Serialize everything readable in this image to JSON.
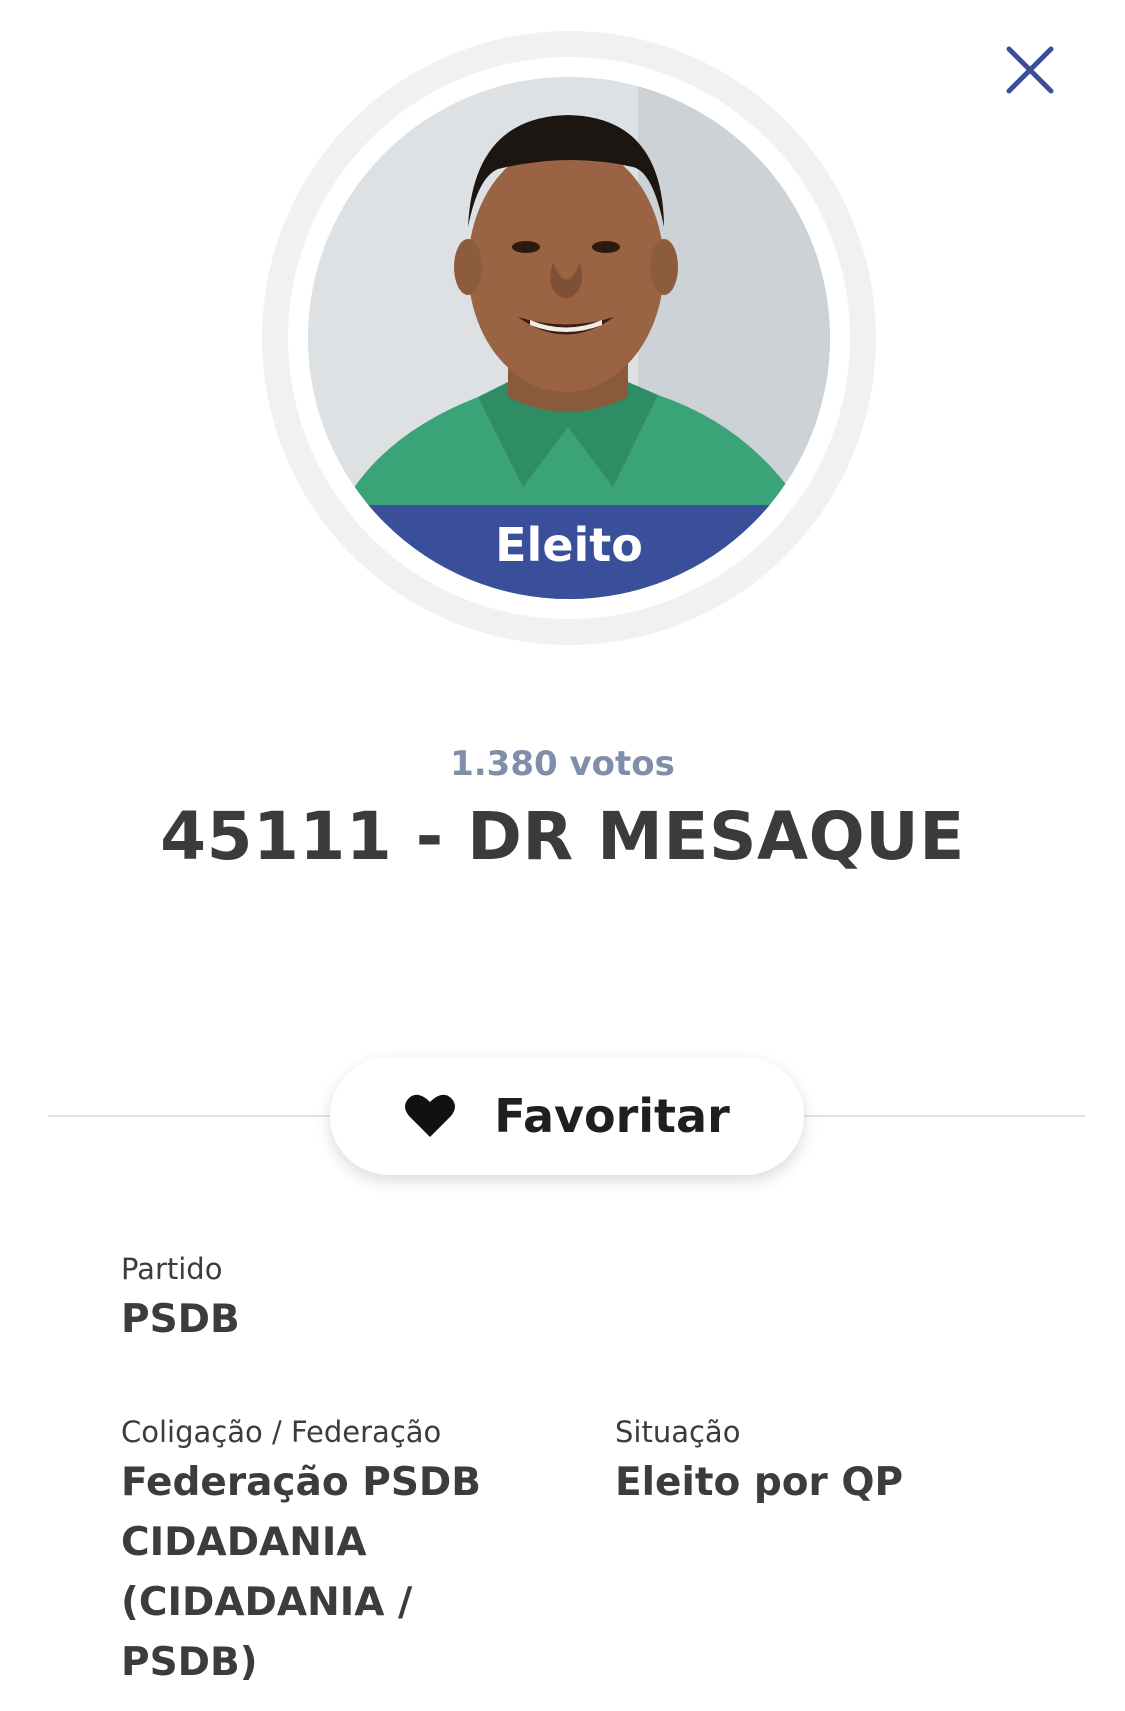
{
  "header": {
    "close_icon": "close-icon"
  },
  "candidate": {
    "photo": "candidate-photo",
    "status_badge": "Eleito",
    "votes": "1.380 votos",
    "title": "45111 - DR MESAQUE"
  },
  "favorite": {
    "icon": "heart-icon",
    "label": "Favoritar"
  },
  "details": {
    "party_label": "Partido",
    "party_value": "PSDB",
    "coalition_label": "Coligação / Federação",
    "coalition_value": "Federação PSDB CIDADANIA (CIDADANIA / PSDB)",
    "situation_label": "Situação",
    "situation_value": "Eleito por QP"
  },
  "colors": {
    "accent": "#3a4f9a",
    "votes_text": "#7f8ea9",
    "close_icon": "#3a4f9a",
    "shirt": "#3aa377"
  }
}
